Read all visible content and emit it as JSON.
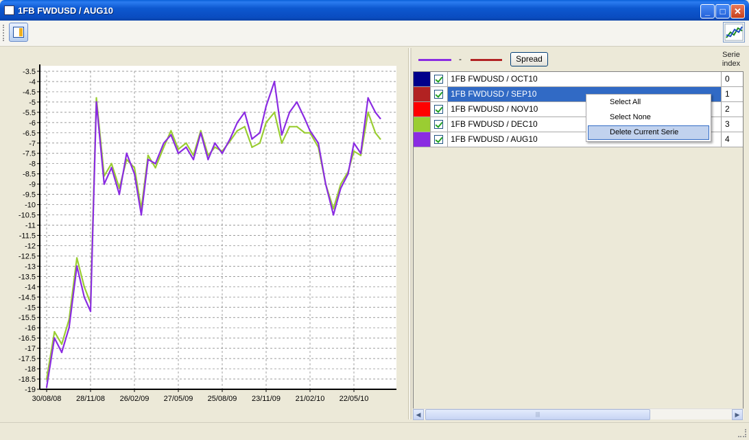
{
  "window": {
    "title": "1FB FWDUSD / AUG10",
    "minimize": "_",
    "maximize": "□",
    "close": "✕"
  },
  "toolbar": {
    "layout_icon": "layout-panel-icon",
    "chart_icon": "chart-trend-icon"
  },
  "legend": {
    "line1_color": "#8a2be2",
    "separator": "-",
    "line2_color": "#b22222",
    "spread_label": "Spread",
    "serie_header_line1": "Serie",
    "serie_header_line2": "index"
  },
  "series_list": [
    {
      "color": "#00008b",
      "checked": true,
      "name": "1FB FWDUSD / OCT10",
      "index": "0"
    },
    {
      "color": "#b22222",
      "checked": true,
      "name": "1FB FWDUSD / SEP10",
      "index": "1",
      "selected": true
    },
    {
      "color": "#ff0000",
      "checked": true,
      "name": "1FB FWDUSD / NOV10",
      "index": "2"
    },
    {
      "color": "#9acd32",
      "checked": true,
      "name": "1FB FWDUSD / DEC10",
      "index": "3"
    },
    {
      "color": "#8a2be2",
      "checked": true,
      "name": "1FB FWDUSD / AUG10",
      "index": "4"
    }
  ],
  "context_menu": {
    "select_all": "Select All",
    "select_none": "Select None",
    "delete_current": "Delete Current Serie"
  },
  "scrollbar": {
    "left": "◀",
    "right": "▶",
    "thumb": "|||"
  },
  "chart_data": {
    "type": "line",
    "title": "",
    "xlabel": "",
    "ylabel": "",
    "ylim": [
      -19,
      -3.5
    ],
    "y_ticks": [
      "-3.5",
      "-4",
      "-4.5",
      "-5",
      "-5.5",
      "-6",
      "-6.5",
      "-7",
      "-7.5",
      "-8",
      "-8.5",
      "-9",
      "-9.5",
      "-10",
      "-10.5",
      "-11",
      "-11.5",
      "-12",
      "-12.5",
      "-13",
      "-13.5",
      "-14",
      "-14.5",
      "-15",
      "-15.5",
      "-16",
      "-16.5",
      "-17",
      "-17.5",
      "-18",
      "-18.5",
      "-19"
    ],
    "x_ticks": [
      "30/08/08",
      "28/11/08",
      "26/02/09",
      "27/05/09",
      "25/08/09",
      "23/11/09",
      "21/02/10",
      "22/05/10"
    ],
    "grid": true,
    "series": [
      {
        "name": "1FB FWDUSD / AUG10",
        "color": "#8a2be2",
        "x": [
          "30/08/08",
          "15/09/08",
          "30/09/08",
          "15/10/08",
          "31/10/08",
          "15/11/08",
          "28/11/08",
          "10/12/08",
          "26/12/08",
          "10/01/09",
          "26/01/09",
          "10/02/09",
          "26/02/09",
          "12/03/09",
          "26/03/09",
          "10/04/09",
          "27/04/09",
          "12/05/09",
          "27/05/09",
          "12/06/09",
          "27/06/09",
          "12/07/09",
          "27/07/09",
          "10/08/09",
          "25/08/09",
          "10/09/09",
          "25/09/09",
          "10/10/09",
          "25/10/09",
          "10/11/09",
          "23/11/09",
          "10/12/09",
          "25/12/09",
          "10/01/10",
          "25/01/10",
          "10/02/10",
          "21/02/10",
          "10/03/10",
          "25/03/10",
          "10/04/10",
          "25/04/10",
          "10/05/10",
          "22/05/10",
          "05/06/10",
          "20/06/10",
          "05/07/10",
          "15/07/10"
        ],
        "values": [
          -18.9,
          -16.5,
          -17.2,
          -16.0,
          -13.0,
          -14.5,
          -15.2,
          -5.0,
          -9.0,
          -8.2,
          -9.5,
          -7.5,
          -8.5,
          -10.5,
          -7.8,
          -8.0,
          -7.0,
          -6.6,
          -7.5,
          -7.2,
          -7.8,
          -6.5,
          -7.8,
          -7.0,
          -7.5,
          -6.8,
          -6.0,
          -5.5,
          -6.8,
          -6.5,
          -5.2,
          -4.0,
          -6.6,
          -5.5,
          -5.0,
          -5.8,
          -6.4,
          -7.0,
          -9.0,
          -10.5,
          -9.2,
          -8.5,
          -7.0,
          -7.5,
          -4.8,
          -5.5,
          -5.8
        ]
      },
      {
        "name": "1FB FWDUSD / DEC10",
        "color": "#9acd32",
        "x": [
          "30/08/08",
          "15/09/08",
          "30/09/08",
          "15/10/08",
          "31/10/08",
          "15/11/08",
          "28/11/08",
          "10/12/08",
          "26/12/08",
          "10/01/09",
          "26/01/09",
          "10/02/09",
          "26/02/09",
          "12/03/09",
          "26/03/09",
          "10/04/09",
          "27/04/09",
          "12/05/09",
          "27/05/09",
          "12/06/09",
          "27/06/09",
          "12/07/09",
          "27/07/09",
          "10/08/09",
          "25/08/09",
          "10/09/09",
          "25/09/09",
          "10/10/09",
          "25/10/09",
          "10/11/09",
          "23/11/09",
          "10/12/09",
          "25/12/09",
          "10/01/10",
          "25/01/10",
          "10/02/10",
          "21/02/10",
          "10/03/10",
          "25/03/10",
          "10/04/10",
          "25/04/10",
          "10/05/10",
          "22/05/10",
          "05/06/10",
          "20/06/10",
          "05/07/10",
          "15/07/10"
        ],
        "values": [
          -18.5,
          -16.2,
          -16.8,
          -15.6,
          -12.6,
          -14.0,
          -14.8,
          -4.8,
          -8.6,
          -8.0,
          -9.2,
          -7.8,
          -8.2,
          -10.2,
          -7.6,
          -8.2,
          -7.2,
          -6.4,
          -7.3,
          -7.0,
          -7.6,
          -6.4,
          -7.6,
          -7.2,
          -7.4,
          -6.9,
          -6.4,
          -6.2,
          -7.2,
          -7.0,
          -6.0,
          -5.5,
          -7.0,
          -6.2,
          -6.2,
          -6.5,
          -6.5,
          -7.2,
          -9.0,
          -10.2,
          -9.0,
          -8.4,
          -7.4,
          -7.6,
          -5.5,
          -6.5,
          -6.8
        ]
      }
    ]
  }
}
